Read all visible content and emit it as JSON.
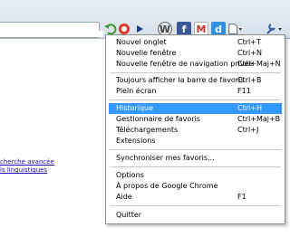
{
  "toolbar": {
    "icons": [
      "reload-icon",
      "shield-icon",
      "play-icon",
      "wordpress-icon",
      "facebook-icon",
      "gmail-icon",
      "d-icon",
      "page-menu-icon",
      "wrench-icon"
    ],
    "wordpress_glyph": "W",
    "facebook_glyph": "f",
    "gmail_glyph": "M",
    "d_glyph": "d"
  },
  "page": {
    "link1": "cherche avancée",
    "link2": "ls linguistiques"
  },
  "menu": {
    "items": [
      {
        "label": "Nouvel onglet",
        "shortcut": "Ctrl+T"
      },
      {
        "label": "Nouvelle fenêtre",
        "shortcut": "Ctrl+N"
      },
      {
        "label": "Nouvelle fenêtre de navigation privée",
        "shortcut": "Ctrl+Maj+N"
      },
      {
        "label": "Toujours afficher la barre de favoris",
        "shortcut": "Ctrl+B"
      },
      {
        "label": "Plein écran",
        "shortcut": "F11"
      },
      {
        "label": "Historique",
        "shortcut": "Ctrl+H"
      },
      {
        "label": "Gestionnaire de favoris",
        "shortcut": "Ctrl+Maj+B"
      },
      {
        "label": "Téléchargements",
        "shortcut": "Ctrl+J"
      },
      {
        "label": "Extensions",
        "shortcut": ""
      },
      {
        "label": "Synchroniser mes favoris...",
        "shortcut": ""
      },
      {
        "label": "Options",
        "shortcut": ""
      },
      {
        "label": "À propos de Google Chrome",
        "shortcut": ""
      },
      {
        "label": "Aide",
        "shortcut": "F1"
      },
      {
        "label": "Quitter",
        "shortcut": ""
      }
    ],
    "highlighted_label": "Historique"
  },
  "colors": {
    "highlight": "#3399ff",
    "link": "#1a0dab"
  }
}
